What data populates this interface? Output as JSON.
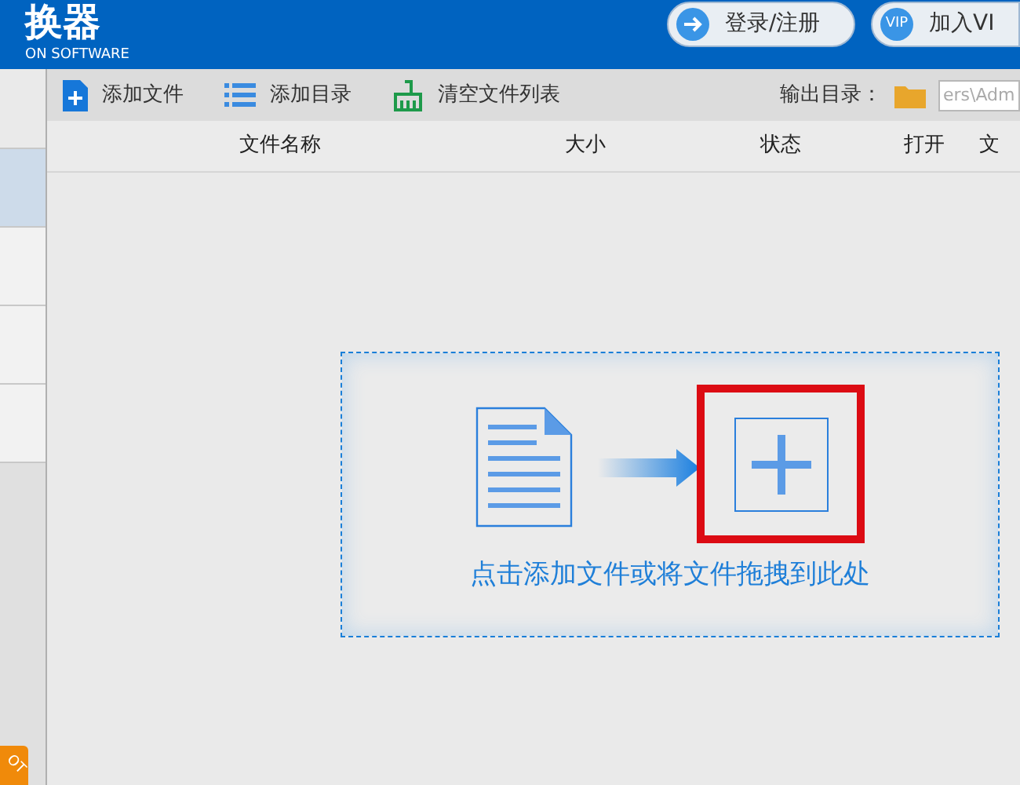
{
  "header": {
    "title": "换器",
    "subtitle": "ON SOFTWARE",
    "buttons": [
      {
        "kind": "login",
        "label": "登录/注册"
      },
      {
        "kind": "vip",
        "icon_text": "VIP",
        "label": "加入VI"
      }
    ]
  },
  "toolbar": {
    "items": [
      {
        "kind": "add-file",
        "label": "添加文件"
      },
      {
        "kind": "add-folder",
        "label": "添加目录"
      },
      {
        "kind": "clear",
        "label": "清空文件列表"
      }
    ],
    "output_label": "输出目录：",
    "output_path": "ers\\Adm"
  },
  "sidebar": {
    "items": [
      {
        "selected": true
      },
      {
        "selected": false
      },
      {
        "selected": false
      },
      {
        "selected": false
      }
    ],
    "badge": "OT"
  },
  "table": {
    "columns": [
      "文件名称",
      "大小",
      "状态",
      "打开",
      "文"
    ]
  },
  "dropzone": {
    "text": "点击添加文件或将文件拖拽到此处",
    "highlighted": true
  }
}
